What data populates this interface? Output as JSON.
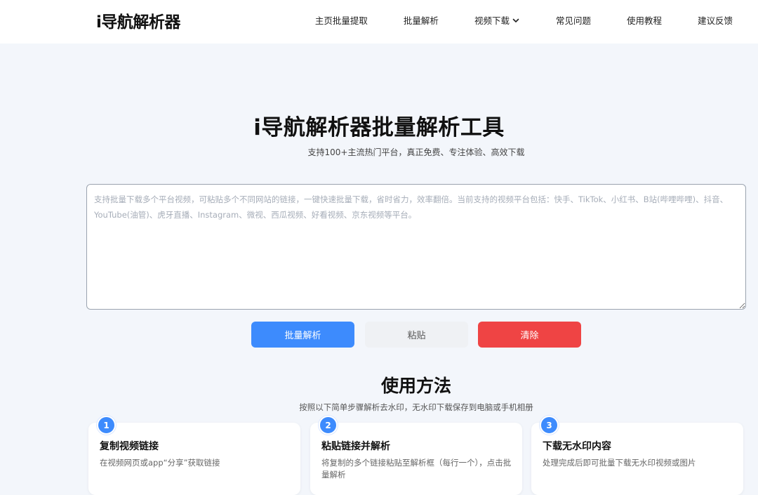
{
  "header": {
    "logo": "i导航解析器",
    "nav": [
      {
        "label": "主页批量提取"
      },
      {
        "label": "批量解析"
      },
      {
        "label": "视频下载",
        "icon": "chevron-down-icon"
      },
      {
        "label": "常见问题"
      },
      {
        "label": "使用教程"
      },
      {
        "label": "建议反馈"
      }
    ]
  },
  "hero": {
    "title": "i导航解析器批量解析工具",
    "subtitle": "支持100+主流热门平台，真正免费、专注体验、高效下载"
  },
  "input": {
    "value": "",
    "placeholder": "支持批量下载多个平台视频，可粘贴多个不同网站的链接，一键快速批量下载，省时省力，效率翻倍。当前支持的视频平台包括：快手、TikTok、小红书、B站(哔哩哔哩)、抖音、YouTube(油管)、虎牙直播、Instagram、微视、西瓜视频、好看视频、京东视频等平台。"
  },
  "buttons": {
    "parse": "批量解析",
    "paste": "粘贴",
    "clear": "清除"
  },
  "usage": {
    "title": "使用方法",
    "subtitle": "按照以下简单步骤解析去水印，无水印下载保存到电脑或手机相册",
    "steps": [
      {
        "number": "1",
        "title": "复制视频链接",
        "desc": "在视频网页或app“分享”获取链接"
      },
      {
        "number": "2",
        "title": "粘贴链接并解析",
        "desc": "将复制的多个链接粘贴至解析框（每行一个），点击批量解析"
      },
      {
        "number": "3",
        "title": "下载无水印内容",
        "desc": "处理完成后即可批量下载无水印视频或图片"
      }
    ]
  },
  "colors": {
    "primary": "#3d8bfd",
    "danger": "#ef4444",
    "background": "#f3f6fb"
  }
}
